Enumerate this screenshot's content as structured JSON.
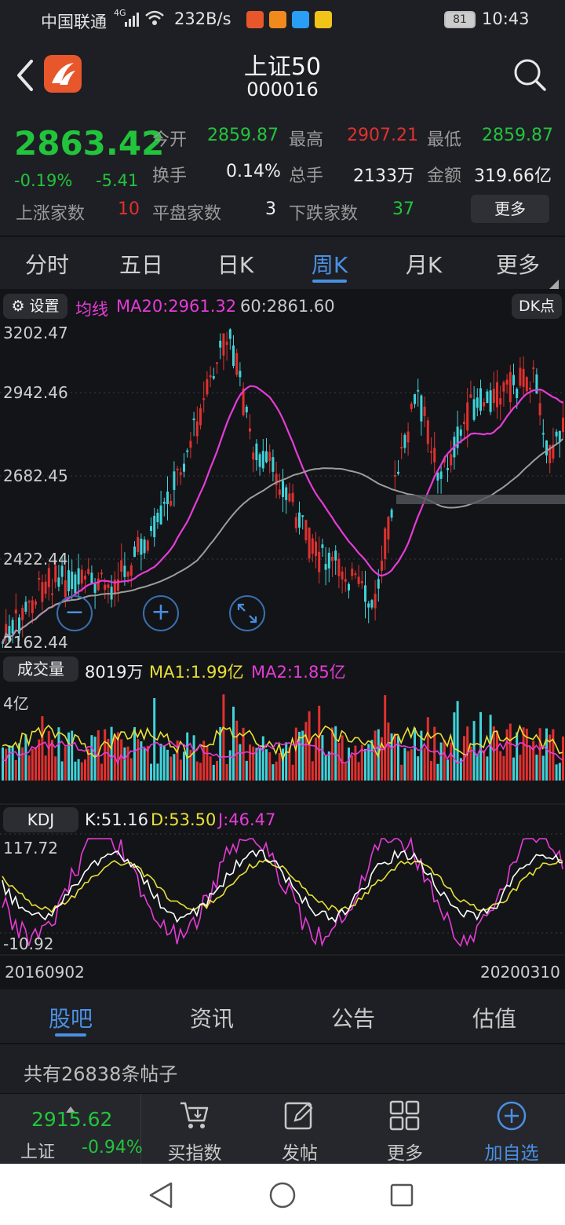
{
  "status_bar": {
    "carrier": "中国联通",
    "network": "4G",
    "speed": "232B/s",
    "battery": "81",
    "time": "10:43"
  },
  "header": {
    "title": "上证50",
    "code": "000016"
  },
  "quote": {
    "price": "2863.42",
    "change_pct": "-0.19%",
    "change": "-5.41",
    "open_label": "今开",
    "open": "2859.87",
    "high_label": "最高",
    "high": "2907.21",
    "low_label": "最低",
    "low": "2859.87",
    "turnover_label": "换手",
    "turnover": "0.14%",
    "volume_label": "总手",
    "volume": "2133万",
    "amount_label": "金额",
    "amount": "319.66亿",
    "up_label": "上涨家数",
    "up": "10",
    "flat_label": "平盘家数",
    "flat": "3",
    "down_label": "下跌家数",
    "down": "37",
    "more_button": "更多"
  },
  "tabs": [
    "分时",
    "五日",
    "日K",
    "周K",
    "月K",
    "更多"
  ],
  "active_tab": 3,
  "kline": {
    "settings_button": "设置",
    "ma_label": "均线",
    "ma20": "MA20:2961.32",
    "ma60": "60:2861.60",
    "dk_button": "DK点",
    "y_labels": [
      "3202.47",
      "2942.46",
      "2682.45",
      "2422.44",
      "2162.44"
    ]
  },
  "volume_panel": {
    "label": "成交量",
    "current": "8019万",
    "ma1": "MA1:1.99亿",
    "ma2": "MA2:1.85亿",
    "y_label": "4亿"
  },
  "kdj_panel": {
    "label": "KDJ",
    "k": "K:51.16",
    "d": "D:53.50",
    "j": "J:46.47",
    "y_top": "117.72",
    "y_bottom": "-10.92"
  },
  "dates": {
    "start": "20160902",
    "end": "20200310"
  },
  "bottom_tabs": [
    "股吧",
    "资讯",
    "公告",
    "估值"
  ],
  "bottom_active": 0,
  "posts_text": "共有26838条帖子",
  "toolbar": {
    "index_value": "2915.62",
    "index_name": "上证",
    "index_change": "-0.94%",
    "buy": "买指数",
    "post": "发帖",
    "more": "更多",
    "add": "加自选"
  },
  "colors": {
    "up": "#e0312f",
    "down": "#3fd3d9",
    "ma20": "#e53cd6",
    "ma60": "#9d9d9d",
    "accent": "#4a90e2",
    "green": "#22c43c",
    "yellow": "#e8e035"
  }
}
